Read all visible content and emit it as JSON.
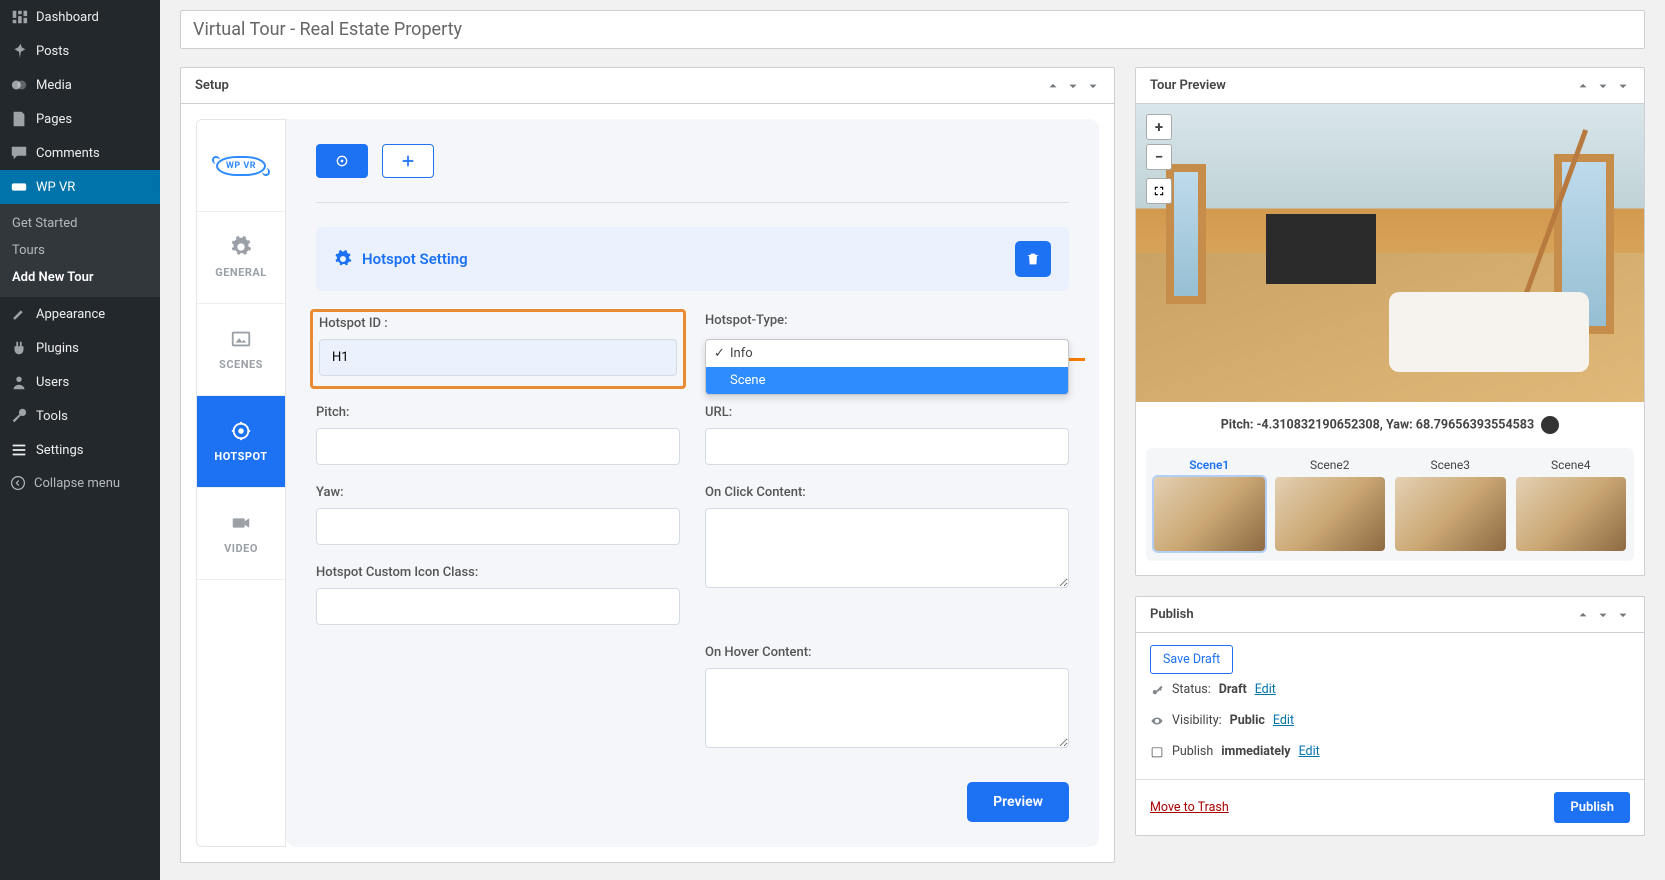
{
  "sidebar": {
    "items": [
      {
        "label": "Dashboard"
      },
      {
        "label": "Posts"
      },
      {
        "label": "Media"
      },
      {
        "label": "Pages"
      },
      {
        "label": "Comments"
      },
      {
        "label": "WP VR"
      }
    ],
    "sub": [
      {
        "label": "Get Started"
      },
      {
        "label": "Tours"
      },
      {
        "label": "Add New Tour"
      }
    ],
    "items2": [
      {
        "label": "Appearance"
      },
      {
        "label": "Plugins"
      },
      {
        "label": "Users"
      },
      {
        "label": "Tools"
      },
      {
        "label": "Settings"
      }
    ],
    "collapse": "Collapse menu"
  },
  "title": "Virtual Tour - Real Estate Property",
  "panels": {
    "setup": "Setup",
    "tourPreview": "Tour Preview",
    "publish": "Publish"
  },
  "tabs": {
    "logo": "WP VR",
    "general": "GENERAL",
    "scenes": "SCENES",
    "hotspot": "HOTSPOT",
    "video": "VIDEO"
  },
  "hotspot": {
    "heading": "Hotspot Setting",
    "id_label": "Hotspot ID :",
    "id_value": "H1",
    "type_label": "Hotspot-Type:",
    "type_options": [
      "Info",
      "Scene"
    ],
    "pitch_label": "Pitch:",
    "yaw_label": "Yaw:",
    "icon_label": "Hotspot Custom Icon Class:",
    "url_label": "URL:",
    "click_label": "On Click Content:",
    "hover_label": "On Hover Content:",
    "preview": "Preview"
  },
  "preview": {
    "coords": "Pitch: -4.310832190652308, Yaw: 68.79656393554583",
    "scenes": [
      "Scene1",
      "Scene2",
      "Scene3",
      "Scene4"
    ]
  },
  "publish": {
    "saveDraft": "Save Draft",
    "status_lbl": "Status:",
    "status_val": "Draft",
    "vis_lbl": "Visibility:",
    "vis_val": "Public",
    "pub_lbl": "Publish",
    "pub_val": "immediately",
    "edit": "Edit",
    "trash": "Move to Trash",
    "button": "Publish"
  }
}
